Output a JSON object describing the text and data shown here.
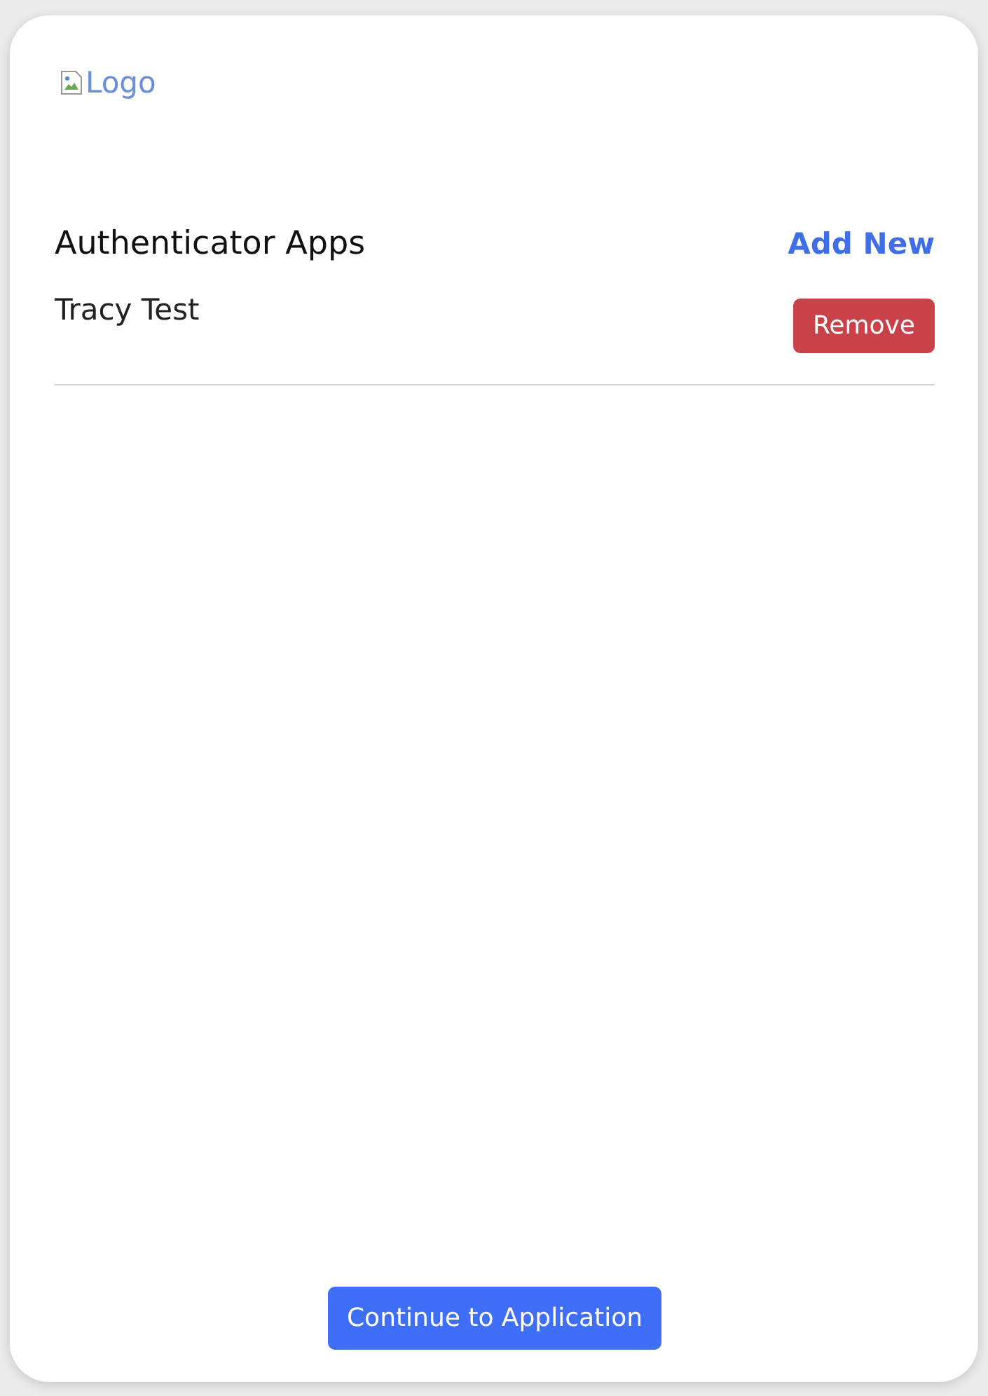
{
  "logo": {
    "alt": "Logo"
  },
  "section": {
    "title": "Authenticator Apps",
    "add_link": "Add New"
  },
  "apps": [
    {
      "name": "Tracy Test",
      "action": "Remove"
    }
  ],
  "footer": {
    "button": "Continue to Application"
  }
}
